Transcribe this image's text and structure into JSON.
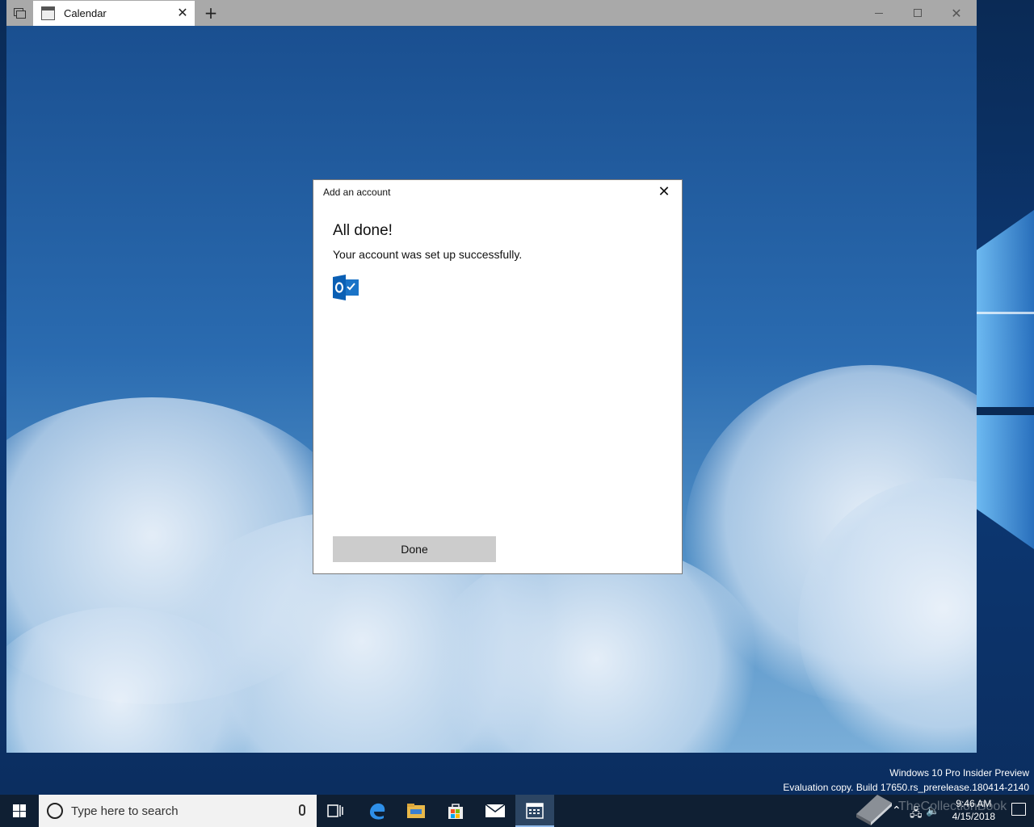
{
  "window": {
    "tab_label": "Calendar",
    "new_tab_label": "+",
    "tab_close_label": "✕",
    "close_label": "✕"
  },
  "dialog": {
    "title": "Add an account",
    "close_label": "✕",
    "heading": "All done!",
    "message": "Your account was set up successfully.",
    "done_label": "Done",
    "account_icon": "outlook-icon"
  },
  "watermark": {
    "line1": "Windows 10 Pro Insider Preview",
    "line2": "Evaluation copy. Build 17650.rs_prerelease.180414-2140"
  },
  "taskbar": {
    "search_placeholder": "Type here to search",
    "pinned_apps": [
      "task-view-icon",
      "edge-icon",
      "file-explorer-icon",
      "store-icon",
      "mail-icon",
      "calendar-icon"
    ],
    "clock_time": "9:46 AM",
    "clock_date": "4/15/2018",
    "tray_logo_text": "TheCollectionBook"
  }
}
